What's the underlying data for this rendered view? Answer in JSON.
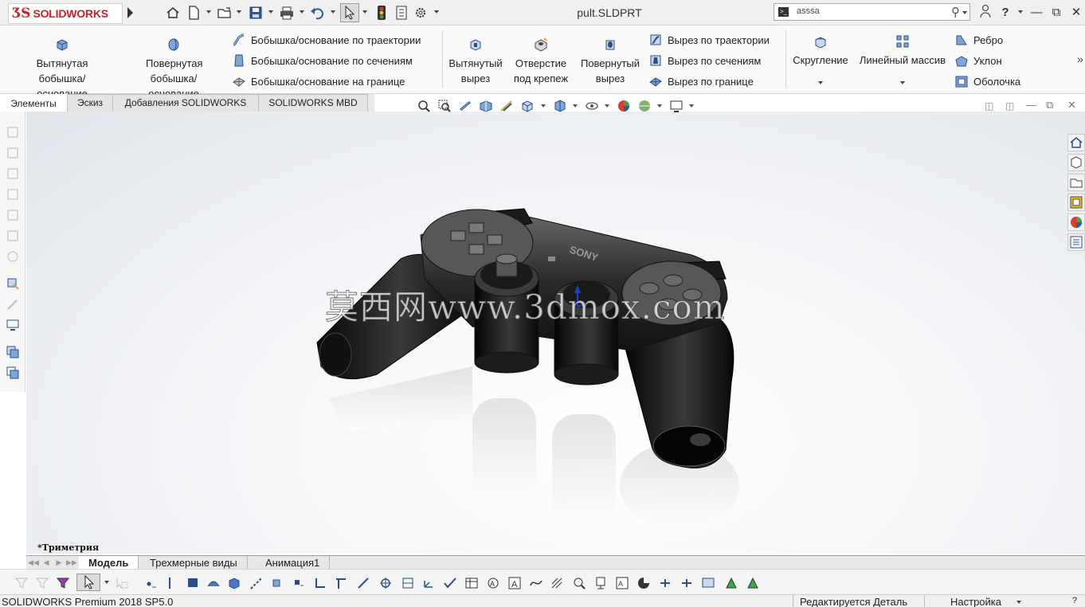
{
  "app": {
    "logo_text": "SOLIDWORKS",
    "document_title": "pult.SLDPRT"
  },
  "search": {
    "value": "asssa"
  },
  "window_controls": [
    "minimize",
    "restore",
    "close"
  ],
  "command_manager": {
    "features": {
      "extruded_boss": "Вытянутая бобышка/основание",
      "revolved_boss": "Повернутая бобышка/основание",
      "swept_boss": "Бобышка/основание по траектории",
      "lofted_boss": "Бобышка/основание по сечениям",
      "boundary_boss": "Бобышка/основание на границе",
      "extruded_cut": "Вытянутый вырез",
      "hole_wizard": "Отверстие под крепеж",
      "revolved_cut": "Повернутый вырез",
      "swept_cut": "Вырез по траектории",
      "lofted_cut": "Вырез по сечениям",
      "boundary_cut": "Вырез по границе",
      "fillet": "Скругление",
      "linear_pattern": "Линейный массив",
      "rib": "Ребро",
      "draft": "Уклон",
      "shell": "Оболочка"
    },
    "tabs": [
      "Элементы",
      "Эскиз",
      "Добавления SOLIDWORKS",
      "SOLIDWORKS MBD"
    ],
    "active_tab": "Элементы"
  },
  "viewport": {
    "orientation_label": "*Триметрия",
    "watermark": "莫西网www.3dmox.com",
    "brand_text": "SONY"
  },
  "model_tabs": {
    "tabs": [
      "Модель",
      "Трехмерные виды",
      "Анимация1"
    ],
    "active": "Модель"
  },
  "status_bar": {
    "product": "SOLIDWORKS Premium 2018 SP5.0",
    "state": "Редактируется Деталь",
    "custom": "Настройка"
  }
}
